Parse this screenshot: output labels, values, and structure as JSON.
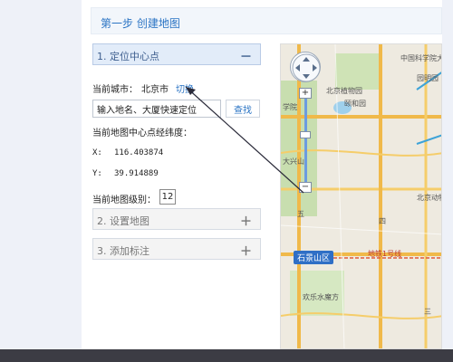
{
  "step": {
    "title": "第一步 创建地图"
  },
  "accordion": [
    {
      "label": "1. 定位中心点",
      "toggle": "－"
    },
    {
      "label": "2. 设置地图",
      "toggle": "＋"
    },
    {
      "label": "3. 添加标注",
      "toggle": "＋"
    }
  ],
  "locate": {
    "city_label": "当前城市：",
    "city_value": "北京市",
    "switch_label": "切换",
    "search_value": "输入地名、大厦快速定位",
    "search_button": "查找",
    "latlng_title": "当前地图中心点经纬度：",
    "x_label": "X:",
    "x_value": "116.403874",
    "y_label": "Y:",
    "y_value": "39.914889",
    "zoom_label": "当前地图级别：",
    "zoom_value": "12"
  },
  "map": {
    "labels": [
      "中国科学院大学",
      "北京植物园",
      "颐和园",
      "园明园",
      "学院",
      "北京动物园",
      "大兴山",
      "五",
      "四",
      "欢乐水魔方",
      "三"
    ],
    "station": "石景山区",
    "subway": "地铁1号线",
    "zoom_plus": "+",
    "zoom_minus": "−"
  },
  "colors": {
    "accent": "#2b74c4",
    "road": "#f0b94a",
    "water": "#3da3d8",
    "green": "#c8deaf"
  }
}
